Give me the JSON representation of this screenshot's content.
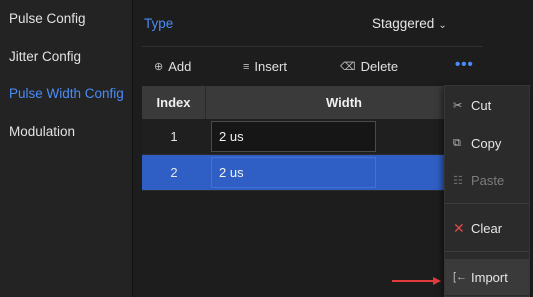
{
  "sidebar": {
    "items": [
      {
        "label": "Pulse Config"
      },
      {
        "label": "Jitter Config"
      },
      {
        "label": "Pulse Width Config"
      },
      {
        "label": "Modulation"
      }
    ],
    "active_index": 2
  },
  "type_row": {
    "label": "Type",
    "value": "Staggered"
  },
  "toolbar": {
    "add_label": "Add",
    "insert_label": "Insert",
    "delete_label": "Delete",
    "more_label": "•••"
  },
  "table": {
    "headers": {
      "index": "Index",
      "width": "Width"
    },
    "rows": [
      {
        "index": "1",
        "width": "2 us",
        "selected": false
      },
      {
        "index": "2",
        "width": "2 us",
        "selected": true
      }
    ]
  },
  "context_menu": {
    "items": [
      {
        "label": "Cut",
        "icon": "scissors-icon",
        "enabled": true
      },
      {
        "label": "Copy",
        "icon": "copy-icon",
        "enabled": true
      },
      {
        "label": "Paste",
        "icon": "paste-icon",
        "enabled": false
      },
      {
        "label": "Clear",
        "icon": "x-icon",
        "enabled": true
      },
      {
        "label": "Import",
        "icon": "import-icon",
        "enabled": true
      }
    ]
  },
  "colors": {
    "accent": "#4a8cf7",
    "selected_row": "#2f5fc4",
    "annotation_arrow": "#e03a3a",
    "clear_icon": "#e04848"
  }
}
